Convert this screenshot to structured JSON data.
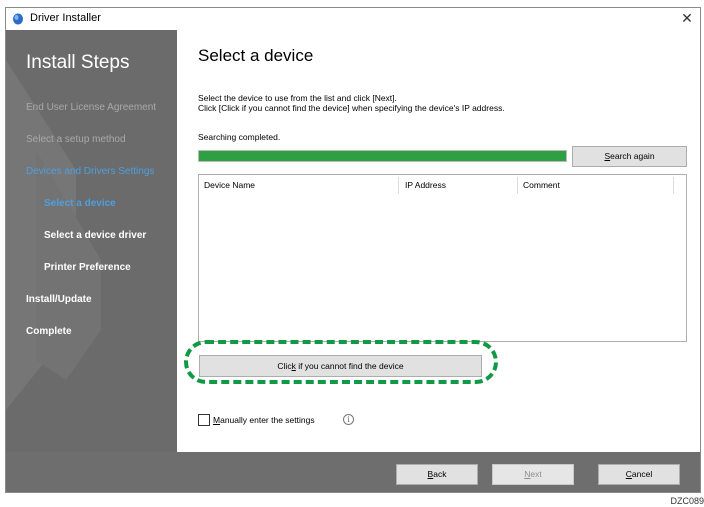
{
  "window": {
    "title": "Driver Installer",
    "close_glyph": "✕"
  },
  "sidebar": {
    "title": "Install Steps",
    "steps": [
      {
        "label": "End User License Agreement",
        "state": "done"
      },
      {
        "label": "Select a setup method",
        "state": "done"
      },
      {
        "label": "Devices and Drivers Settings",
        "state": "current-group"
      },
      {
        "label": "Select a device",
        "state": "current"
      },
      {
        "label": "Select a device driver",
        "state": "pending"
      },
      {
        "label": "Printer Preference",
        "state": "pending"
      },
      {
        "label": "Install/Update",
        "state": "pending"
      },
      {
        "label": "Complete",
        "state": "pending"
      }
    ]
  },
  "main": {
    "heading": "Select a device",
    "instruction_line1": "Select the device to use from the list and click [Next].",
    "instruction_line2": "Click [Click if you cannot find the device] when specifying the device's IP address.",
    "status": "Searching completed.",
    "progress_fraction": 1.0,
    "search_again": {
      "accel": "S",
      "rest": "earch again"
    },
    "table": {
      "columns": [
        "Device Name",
        "IP Address",
        "Comment"
      ],
      "rows": []
    },
    "not_found": {
      "pre": "Clic",
      "accel": "k",
      "post": " if you cannot find the device"
    },
    "manual": {
      "accel": "M",
      "rest": "anually enter the settings",
      "checked": false
    },
    "info_icon": "i"
  },
  "footer": {
    "back": {
      "accel": "B",
      "rest": "ack"
    },
    "next": {
      "accel": "N",
      "rest": "ext"
    },
    "cancel": {
      "accel": "C",
      "rest": "ancel"
    }
  },
  "doc_code": "DZC089",
  "colors": {
    "accent_blue": "#4f9fe0",
    "progress_green": "#2ea043",
    "highlight_green": "#119946",
    "panel_gray": "#6e6e6e"
  }
}
